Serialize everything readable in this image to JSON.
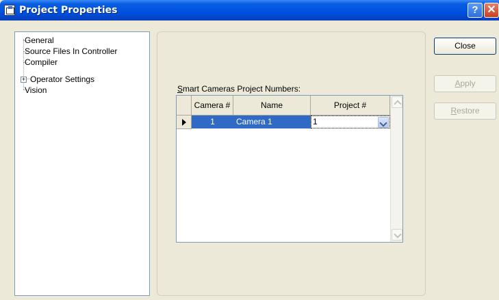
{
  "window": {
    "title": "Project Properties",
    "help_label": "?",
    "close_label": "✕"
  },
  "tree": {
    "items": [
      {
        "label": "General",
        "expandable": false
      },
      {
        "label": "Source Files In Controller",
        "expandable": false
      },
      {
        "label": "Compiler",
        "expandable": false
      },
      {
        "label": "Operator Settings",
        "expandable": true,
        "expander": "+"
      },
      {
        "label": "Vision",
        "expandable": false
      }
    ]
  },
  "grid": {
    "label_mnemonic": "S",
    "label_rest": "mart Cameras Project Numbers:",
    "columns": [
      "Camera #",
      "Name",
      "Project #"
    ],
    "rows": [
      {
        "camera": "1",
        "name": "Camera 1",
        "project": "1"
      }
    ]
  },
  "buttons": {
    "close": "Close",
    "apply_mnemonic": "A",
    "apply_rest": "pply",
    "restore_mnemonic": "R",
    "restore_rest": "estore"
  }
}
